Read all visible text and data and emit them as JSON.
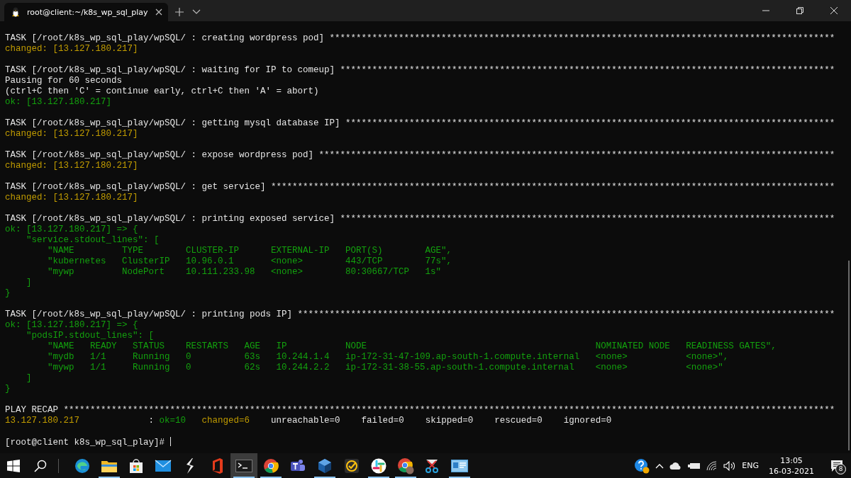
{
  "window": {
    "tab_title": "root@client:~/k8s_wp_sql_play"
  },
  "terminal": {
    "lines": [
      {
        "kind": "default",
        "text": "TASK [/root/k8s_wp_sql_play/wpSQL/ : creating wordpress pod] ***********************************************************************************************"
      },
      {
        "kind": "changed",
        "text": "changed: [13.127.180.217]"
      },
      {
        "kind": "blank"
      },
      {
        "kind": "default",
        "text": "TASK [/root/k8s_wp_sql_play/wpSQL/ : waiting for IP to comeup] *********************************************************************************************"
      },
      {
        "kind": "default",
        "text": "Pausing for 60 seconds"
      },
      {
        "kind": "default",
        "text": "(ctrl+C then 'C' = continue early, ctrl+C then 'A' = abort)"
      },
      {
        "kind": "ok",
        "text": "ok: [13.127.180.217]"
      },
      {
        "kind": "blank"
      },
      {
        "kind": "default",
        "text": "TASK [/root/k8s_wp_sql_play/wpSQL/ : getting mysql database IP] ********************************************************************************************"
      },
      {
        "kind": "changed",
        "text": "changed: [13.127.180.217]"
      },
      {
        "kind": "blank"
      },
      {
        "kind": "default",
        "text": "TASK [/root/k8s_wp_sql_play/wpSQL/ : expose wordpress pod] *************************************************************************************************"
      },
      {
        "kind": "changed",
        "text": "changed: [13.127.180.217]"
      },
      {
        "kind": "blank"
      },
      {
        "kind": "default",
        "text": "TASK [/root/k8s_wp_sql_play/wpSQL/ : get service] **********************************************************************************************************"
      },
      {
        "kind": "changed",
        "text": "changed: [13.127.180.217]"
      },
      {
        "kind": "blank"
      },
      {
        "kind": "default",
        "text": "TASK [/root/k8s_wp_sql_play/wpSQL/ : printing exposed service] *********************************************************************************************"
      },
      {
        "kind": "ok",
        "text": "ok: [13.127.180.217] => {"
      },
      {
        "kind": "ok",
        "text": "    \"service.stdout_lines\": ["
      },
      {
        "kind": "ok",
        "text": "        \"NAME         TYPE        CLUSTER-IP      EXTERNAL-IP   PORT(S)        AGE\","
      },
      {
        "kind": "ok",
        "text": "        \"kubernetes   ClusterIP   10.96.0.1       <none>        443/TCP        77s\","
      },
      {
        "kind": "ok",
        "text": "        \"mywp         NodePort    10.111.233.98   <none>        80:30667/TCP   1s\""
      },
      {
        "kind": "ok",
        "text": "    ]"
      },
      {
        "kind": "ok",
        "text": "}"
      },
      {
        "kind": "blank"
      },
      {
        "kind": "default",
        "text": "TASK [/root/k8s_wp_sql_play/wpSQL/ : printing pods IP] *****************************************************************************************************"
      },
      {
        "kind": "ok",
        "text": "ok: [13.127.180.217] => {"
      },
      {
        "kind": "ok",
        "text": "    \"podsIP.stdout_lines\": ["
      },
      {
        "kind": "ok",
        "text": "        \"NAME   READY   STATUS    RESTARTS   AGE   IP           NODE                                           NOMINATED NODE   READINESS GATES\","
      },
      {
        "kind": "ok",
        "text": "        \"mydb   1/1     Running   0          63s   10.244.1.4   ip-172-31-47-109.ap-south-1.compute.internal   <none>           <none>\","
      },
      {
        "kind": "ok",
        "text": "        \"mywp   1/1     Running   0          62s   10.244.2.2   ip-172-31-38-55.ap-south-1.compute.internal    <none>           <none>\""
      },
      {
        "kind": "ok",
        "text": "    ]"
      },
      {
        "kind": "ok",
        "text": "}"
      },
      {
        "kind": "blank"
      },
      {
        "kind": "default",
        "text": "PLAY RECAP *************************************************************************************************************************************************"
      },
      {
        "kind": "mixed",
        "segments": [
          {
            "kind": "changed",
            "text": "13.127.180.217"
          },
          {
            "kind": "default",
            "text": "             : "
          },
          {
            "kind": "ok",
            "text": "ok=10   "
          },
          {
            "kind": "changed",
            "text": "changed=6"
          },
          {
            "kind": "default",
            "text": "    unreachable=0    failed=0    skipped=0    rescued=0    ignored=0"
          }
        ]
      },
      {
        "kind": "blank"
      },
      {
        "kind": "prompt",
        "text": "[root@client k8s_wp_sql_play]#"
      }
    ]
  },
  "taskbar": {
    "apps": [
      {
        "kind": "edge",
        "running": false,
        "selected": false
      },
      {
        "kind": "folder",
        "running": true,
        "selected": false
      },
      {
        "kind": "store",
        "running": false,
        "selected": false
      },
      {
        "kind": "mail",
        "running": false,
        "selected": false
      },
      {
        "kind": "bolt",
        "running": false,
        "selected": false
      },
      {
        "kind": "office",
        "running": false,
        "selected": false
      },
      {
        "kind": "terminal",
        "running": true,
        "selected": true
      },
      {
        "kind": "chrome",
        "running": true,
        "selected": false
      },
      {
        "kind": "teams",
        "running": false,
        "selected": false
      },
      {
        "kind": "cube",
        "running": true,
        "selected": false
      },
      {
        "kind": "check",
        "running": false,
        "selected": false
      },
      {
        "kind": "slack",
        "running": true,
        "selected": false
      },
      {
        "kind": "chromebadge",
        "running": true,
        "selected": false
      },
      {
        "kind": "scissors",
        "running": false,
        "selected": false
      },
      {
        "kind": "card",
        "running": true,
        "selected": false
      }
    ],
    "language": "ENG",
    "time": "13:05",
    "date": "16-03-2021",
    "notifications": "8"
  }
}
